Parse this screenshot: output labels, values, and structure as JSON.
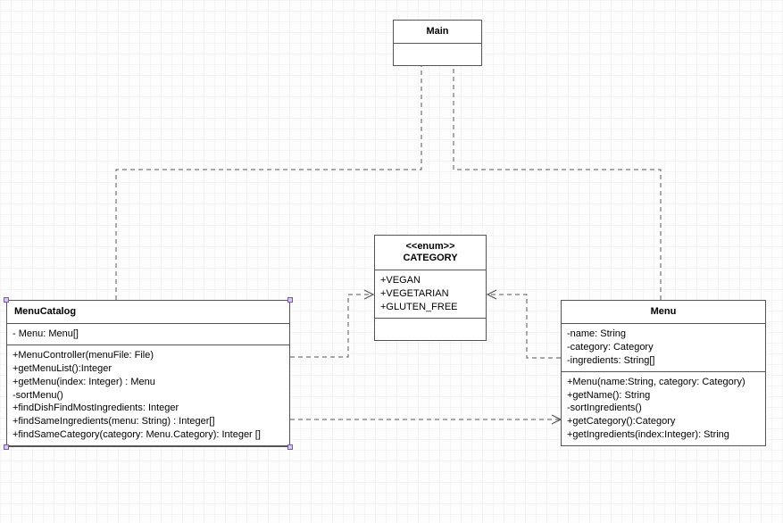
{
  "classes": {
    "main": {
      "title": "Main"
    },
    "category": {
      "stereotype": "<<enum>>",
      "title": "CATEGORY",
      "values": [
        "+VEGAN",
        "+VEGETARIAN",
        "+GLUTEN_FREE"
      ]
    },
    "menuCatalog": {
      "title": "MenuCatalog",
      "attributes": [
        "- Menu: Menu[]"
      ],
      "operations": [
        "+MenuController(menuFile: File)",
        "+getMenuList():Integer",
        "+getMenu(index: Integer) : Menu",
        "-sortMenu()",
        "+findDishFindMostIngredients: Integer",
        "+findSameIngredients(menu: String) : Integer[]",
        "+findSameCategory(category: Menu.Category): Integer []"
      ]
    },
    "menu": {
      "title": "Menu",
      "attributes": [
        "-name: String",
        "-category: Category",
        "-ingredients: String[]"
      ],
      "operations": [
        "+Menu(name:String, category: Category)",
        "+getName(): String",
        "-sortIngredients()",
        "+getCategory():Category",
        "+getIngredients(index:Integer): String"
      ]
    }
  }
}
